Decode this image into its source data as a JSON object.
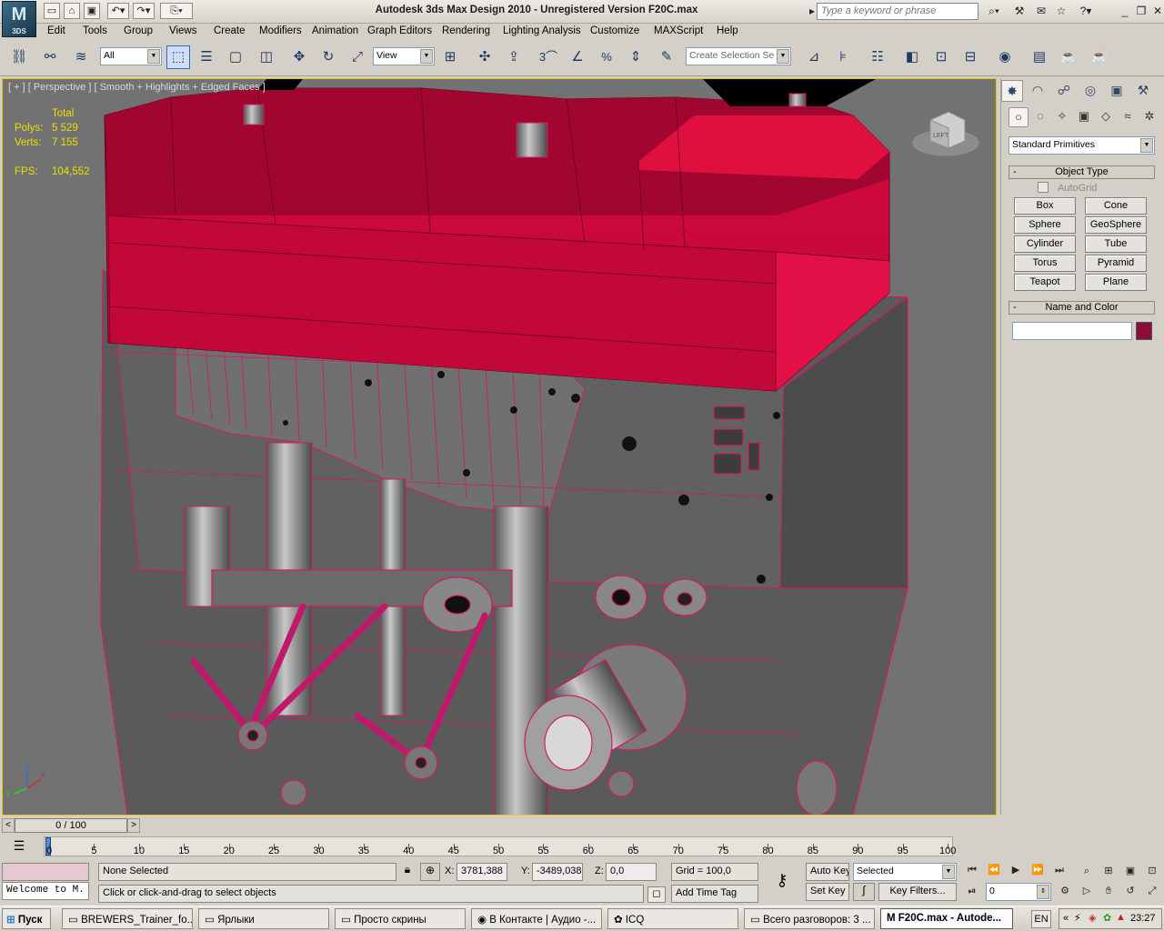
{
  "app": {
    "title": "Autodesk 3ds Max Design 2010  - Unregistered Version    F20C.max",
    "logo_text": "3DS",
    "search_placeholder": "Type a keyword or phrase"
  },
  "menu": [
    "Edit",
    "Tools",
    "Group",
    "Views",
    "Create",
    "Modifiers",
    "Animation",
    "Graph Editors",
    "Rendering",
    "Lighting Analysis",
    "Customize",
    "MAXScript",
    "Help"
  ],
  "toolbar": {
    "filter_value": "All",
    "refcoord_value": "View",
    "named_selection_placeholder": "Create Selection Se",
    "snap_count": "3",
    "percent_snap": "%"
  },
  "viewport": {
    "label": "[ + ] [ Perspective ] [ Smooth + Highlights + Edged Faces ]",
    "stats": {
      "header": "Total",
      "polys_label": "Polys:",
      "polys_value": "5 529",
      "verts_label": "Verts:",
      "verts_value": "7 155",
      "fps_label": "FPS:",
      "fps_value": "104,552"
    },
    "gizmo_label": "LEFT",
    "axes": {
      "x": "x",
      "y": "y",
      "z": "z"
    }
  },
  "command_panel": {
    "dropdown_value": "Standard Primitives",
    "object_type_title": "Object Type",
    "autogrid_label": "AutoGrid",
    "buttons": [
      "Box",
      "Cone",
      "Sphere",
      "GeoSphere",
      "Cylinder",
      "Tube",
      "Torus",
      "Pyramid",
      "Teapot",
      "Plane"
    ],
    "name_color_title": "Name and Color",
    "name_value": "",
    "object_color": "#8b0d3c"
  },
  "timeline": {
    "slider_label": "0 / 100",
    "ticks": [
      "0",
      "5",
      "10",
      "15",
      "20",
      "25",
      "30",
      "35",
      "40",
      "45",
      "50",
      "55",
      "60",
      "65",
      "70",
      "75",
      "80",
      "85",
      "90",
      "95",
      "100"
    ]
  },
  "status": {
    "script_text": "Welcome to M.",
    "selection_text": "None Selected",
    "prompt_text": "Click or click-and-drag to select objects",
    "x_label": "X:",
    "x_value": "3781,388",
    "y_label": "Y:",
    "y_value": "-3489,038",
    "z_label": "Z:",
    "z_value": "0,0",
    "grid_text": "Grid = 100,0",
    "add_time_tag": "Add Time Tag",
    "auto_key": "Auto Key",
    "set_key": "Set Key",
    "key_mode_value": "Selected",
    "key_filters": "Key Filters...",
    "frame_value": "0"
  },
  "taskbar": {
    "start": "Пуск",
    "tasks": [
      "BREWERS_Trainer_fo...",
      "Ярлыки",
      "Просто скрины",
      "В Контакте | Аудио -...",
      "ICQ",
      "Всего разговоров: 3 ...",
      "F20C.max - Autode..."
    ],
    "language": "EN",
    "clock": "23:27"
  },
  "colors": {
    "viewport_bg": "#727272",
    "mesh_red": "#c8083c",
    "mesh_grey": "#5d5d5d",
    "wire": "#d01a66",
    "stat_yellow": "#e8e000"
  }
}
